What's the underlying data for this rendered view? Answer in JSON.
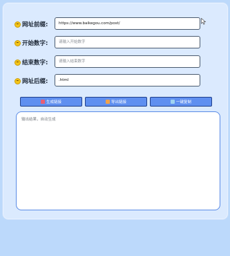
{
  "form": {
    "prefix": {
      "label": "网址前缀:",
      "value": "https://www.baikegou.com/post/",
      "placeholder": ""
    },
    "start": {
      "label": "开始数字:",
      "value": "",
      "placeholder": "请输入开始数字"
    },
    "end": {
      "label": "结束数字:",
      "value": "",
      "placeholder": "请输入结束数字"
    },
    "suffix": {
      "label": "网址后缀:",
      "value": ".html",
      "placeholder": ""
    }
  },
  "buttons": {
    "generate": "生成链接",
    "export": "导出链接",
    "copy": "一键复制"
  },
  "output": {
    "placeholder": "输出结果，自动生成"
  },
  "icons": {
    "label_emoji": "smiley-emoji-icon",
    "generate": "pencil-icon",
    "export": "gift-icon",
    "copy": "clipboard-icon"
  },
  "colors": {
    "button_bg": "#5f8ff0",
    "button_border": "#1f3f8a",
    "output_border": "#5a8be6",
    "page_bg": "#bcd9fb"
  }
}
